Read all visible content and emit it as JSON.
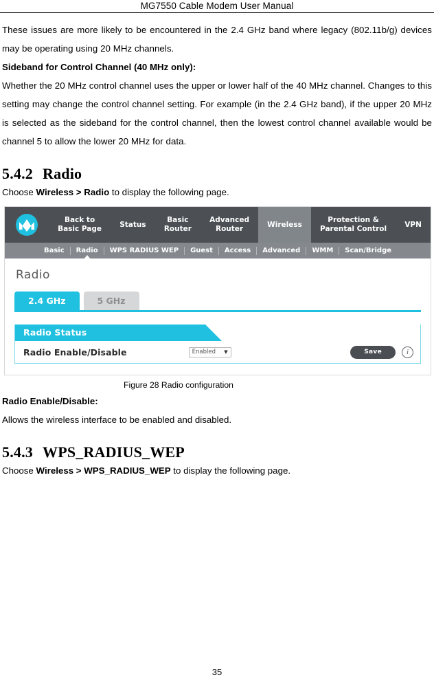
{
  "document": {
    "running_header": "MG7550 Cable Modem User Manual",
    "page_number": "35"
  },
  "paragraphs": {
    "intro": "These issues are more likely to be encountered in the 2.4 GHz band where legacy (802.11b/g) devices may be operating using 20 MHz channels.",
    "sideband_heading": "Sideband for Control Channel (40 MHz only):",
    "sideband_body": "Whether the 20 MHz control channel uses the upper or lower half of the 40 MHz channel. Changes to this setting may change the control channel setting. For example (in the 2.4 GHz band), if the upper 20 MHz is selected as the sideband for the control channel, then the lowest control channel available would be channel 5 to allow the lower 20 MHz for data.",
    "radio_enable_heading": "Radio Enable/Disable:",
    "radio_enable_body": "Allows the wireless interface to be enabled and disabled."
  },
  "sections": {
    "radio": {
      "number": "5.4.2",
      "title": "Radio",
      "choose_prefix": "Choose ",
      "choose_path": "Wireless > Radio",
      "choose_suffix": " to display the following page."
    },
    "wps": {
      "number": "5.4.3",
      "title": "WPS_RADIUS_WEP",
      "choose_prefix": "Choose ",
      "choose_path": "Wireless > WPS_RADIUS_WEP",
      "choose_suffix": " to display the following page."
    }
  },
  "figure": {
    "caption": "Figure 28 Radio configuration"
  },
  "screenshot": {
    "logo_name": "motorola-logo",
    "primary_nav": [
      {
        "label": "Back to\nBasic Page",
        "active": false
      },
      {
        "label": "Status",
        "active": false
      },
      {
        "label": "Basic\nRouter",
        "active": false
      },
      {
        "label": "Advanced\nRouter",
        "active": false
      },
      {
        "label": "Wireless",
        "active": true
      },
      {
        "label": "Protection &\nParental Control",
        "active": false
      },
      {
        "label": "VPN",
        "active": false
      }
    ],
    "sub_nav": [
      {
        "label": "Basic",
        "active": false
      },
      {
        "label": "Radio",
        "active": true
      },
      {
        "label": "WPS RADIUS WEP",
        "active": false
      },
      {
        "label": "Guest",
        "active": false
      },
      {
        "label": "Access",
        "active": false
      },
      {
        "label": "Advanced",
        "active": false
      },
      {
        "label": "WMM",
        "active": false
      },
      {
        "label": "Scan/Bridge",
        "active": false
      }
    ],
    "panel_title": "Radio",
    "band_tabs": [
      {
        "label": "2.4 GHz",
        "active": true
      },
      {
        "label": "5 GHz",
        "active": false
      }
    ],
    "card": {
      "banner": "Radio Status",
      "row_label": "Radio Enable/Disable",
      "select_value": "Enabled",
      "select_arrow": "▼",
      "save_label": "Save",
      "info_label": "i"
    },
    "colors": {
      "accent_cyan": "#1fc0e0",
      "nav_dark": "#4c5055",
      "nav_active": "#81868b",
      "subnav_gray": "#85898e",
      "save_dark": "#4a4d52"
    }
  }
}
